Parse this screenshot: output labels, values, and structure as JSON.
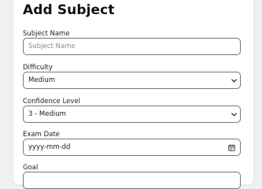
{
  "form": {
    "title": "Add Subject",
    "subject_name": {
      "label": "Subject Name",
      "placeholder": "Subject Name",
      "value": ""
    },
    "difficulty": {
      "label": "Difficulty",
      "selected": "Medium"
    },
    "confidence": {
      "label": "Confidence Level",
      "selected": "3 - Medium"
    },
    "exam_date": {
      "label": "Exam Date",
      "placeholder": "yyyy-mm-dd"
    },
    "goal": {
      "label": "Goal"
    }
  },
  "icons": {
    "select_arrow": "chevron-down-icon",
    "date_picker": "calendar-icon"
  }
}
